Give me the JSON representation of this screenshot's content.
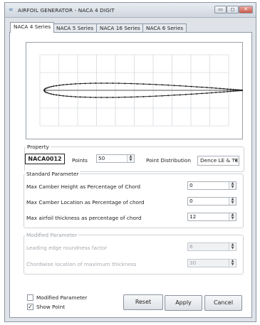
{
  "window": {
    "title": "AIRFOIL GENERATOR - NACA 4 DIGIT",
    "app_icon": "airfoil-app-icon",
    "min_glyph": "▭",
    "max_glyph": "◻",
    "close_glyph": "✕"
  },
  "tabs": [
    {
      "label": "NACA 4 Series",
      "active": true
    },
    {
      "label": "NACA 5 Series",
      "active": false
    },
    {
      "label": "NACA 16 Series",
      "active": false
    },
    {
      "label": "NACA 6 Series",
      "active": false
    }
  ],
  "property": {
    "label": "Property",
    "naca_code": "NACA0012",
    "points_label": "Points",
    "points_value": "50",
    "distribution_label": "Point Distribution",
    "distribution_value": "Dence LE & TE"
  },
  "standard": {
    "label": "Standard Parameter",
    "camber_height_label": "Max Camber Height as Percentage of Chord",
    "camber_height_value": "0",
    "camber_location_label": "Max Camber Location as Percentage of chord",
    "camber_location_value": "0",
    "thickness_label": "Max airfoil thickness as percentage of chord",
    "thickness_value": "12"
  },
  "modified": {
    "label": "Modified Parameter",
    "le_roundness_label": "Leading edge roundness factor",
    "le_roundness_value": "6",
    "chordwise_label": "Chordwise location of maximum thickness",
    "chordwise_value": "30"
  },
  "options": {
    "modified_label": "Modified Parameter",
    "modified_checked": false,
    "show_point_label": "Show Point",
    "show_point_checked": true,
    "check_glyph": "✓"
  },
  "buttons": {
    "reset": "Reset",
    "apply": "Apply",
    "cancel": "Cancel"
  },
  "spin_up": "▲",
  "spin_down": "▼",
  "combo_arrow": "▾",
  "colors": {
    "airfoil": "#222222",
    "grid": "#c8ccd2"
  }
}
